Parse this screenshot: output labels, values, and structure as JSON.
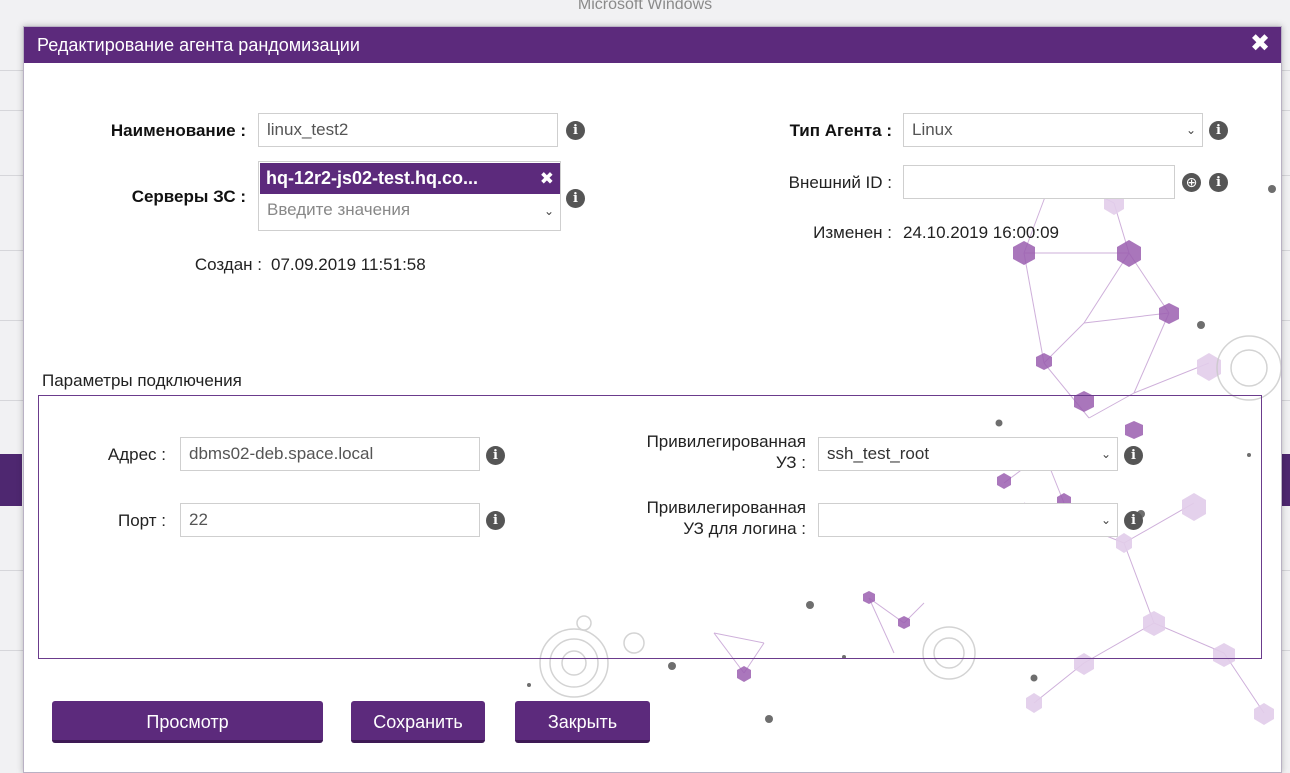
{
  "background": {
    "window_title": "Microsoft Windows"
  },
  "dialog": {
    "title": "Редактирование агента рандомизации",
    "close_icon": "close-icon",
    "name_label": "Наименование :",
    "name_value": "linux_test2",
    "servers_label": "Серверы ЗС :",
    "servers_tag": "hq-12r2-js02-test.hq.co...",
    "servers_tag_remove": "✖",
    "servers_placeholder": "Введите значения",
    "created_label": "Создан :",
    "created_value": "07.09.2019 11:51:58",
    "agent_type_label": "Тип Агента :",
    "agent_type_value": "Linux",
    "external_id_label": "Внешний ID :",
    "external_id_value": "",
    "modified_label": "Изменен :",
    "modified_value": "24.10.2019 16:00:09"
  },
  "connection": {
    "section_title": "Параметры подключения",
    "address_label": "Адрес :",
    "address_value": "dbms02-deb.space.local",
    "port_label": "Порт :",
    "port_value": "22",
    "priv_account_label_1": "Привилегированная",
    "priv_account_label_2": "УЗ :",
    "priv_account_value": "ssh_test_root",
    "priv_login_label_1": "Привилегированная",
    "priv_login_label_2": "УЗ для логина :",
    "priv_login_value": ""
  },
  "buttons": {
    "preview": "Просмотр",
    "save": "Сохранить",
    "close": "Закрыть"
  },
  "icons": {
    "info": "i",
    "globe": "⊕"
  },
  "colors": {
    "accent": "#5c2a7c",
    "accent_dark": "#3e1a55",
    "decor": "#9b5fb0"
  }
}
